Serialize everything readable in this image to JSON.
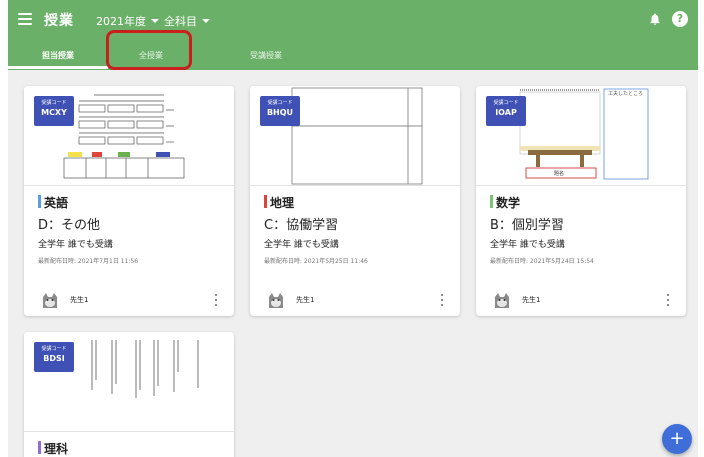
{
  "app": {
    "title": "授業"
  },
  "header": {
    "year_selector": "2021年度",
    "subject_selector": "全科目"
  },
  "tabs": [
    {
      "label": "担当授業",
      "active": true
    },
    {
      "label": "全授業",
      "active": false,
      "highlighted": true
    },
    {
      "label": "受講授業",
      "active": false
    }
  ],
  "cards": [
    {
      "code_label": "受講コード",
      "code": "MCXY",
      "subject": "英語",
      "subject_color": "#5c9ce6",
      "style": "D：その他",
      "grade": "全学年 誰でも受講",
      "date": "最新配布日時: 2021年7月1日 11:56",
      "teacher": "先生1"
    },
    {
      "code_label": "受講コード",
      "code": "BHQU",
      "subject": "地理",
      "subject_color": "#d9453d",
      "style": "C：協働学習",
      "grade": "全学年 誰でも受講",
      "date": "最新配布日時: 2021年5月25日 11:46",
      "teacher": "先生1"
    },
    {
      "code_label": "受講コード",
      "code": "IOAP",
      "subject": "数学",
      "subject_color": "#7cc576",
      "style": "B：個別学習",
      "grade": "全学年 誰でも受講",
      "date": "最新配布日時: 2021年5月24日 15:54",
      "teacher": "先生1"
    },
    {
      "code_label": "受講コード",
      "code": "BDSI",
      "subject": "理科",
      "subject_color": "#8e6fd9"
    }
  ],
  "thumbnails": {
    "math_note": "工夫したところ",
    "math_caption": "題名"
  },
  "colors": {
    "appbar": "#6bb068",
    "badge": "#3f51b5",
    "fab": "#3f6ed8",
    "highlight": "#c9201e"
  },
  "icons": {
    "menu": "menu-icon",
    "bell": "bell-icon",
    "help": "help-icon",
    "more": "more-vert-icon",
    "add": "add-icon"
  },
  "fab_label": "+"
}
